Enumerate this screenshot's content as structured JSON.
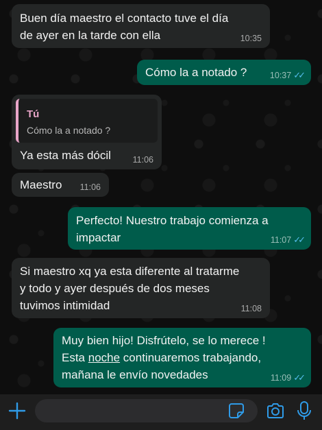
{
  "messages": [
    {
      "direction": "incoming",
      "lines": [
        "Buen día maestro el contacto tuve el día",
        "de ayer en la tarde  con ella"
      ],
      "time": "10:35"
    },
    {
      "direction": "outgoing",
      "text": "Cómo la a notado ?",
      "time": "10:37",
      "status": "read"
    },
    {
      "direction": "incoming",
      "reply_to": {
        "author": "Tú",
        "text": "Cómo la a notado ?"
      },
      "text": "Ya esta más dócil",
      "time": "11:06"
    },
    {
      "direction": "incoming",
      "text": "Maestro",
      "time": "11:06"
    },
    {
      "direction": "outgoing",
      "lines": [
        "Perfecto! Nuestro trabajo comienza a",
        "impactar"
      ],
      "time": "11:07",
      "status": "read"
    },
    {
      "direction": "incoming",
      "lines": [
        "Si maestro xq ya esta diferente al tratarme",
        "y todo y ayer después de dos meses",
        "tuvimos intimidad"
      ],
      "time": "11:08"
    },
    {
      "direction": "outgoing",
      "lines": [
        "Muy bien hijo! Disfrútelo, se lo merece !",
        "Esta ",
        "noche",
        " continuaremos trabajando,",
        "mañana le envío novedades"
      ],
      "time": "11:09",
      "status": "read"
    }
  ],
  "composer": {
    "placeholder": ""
  },
  "icons": {
    "attach": "plus-icon",
    "sticker": "sticker-icon",
    "camera": "camera-icon",
    "microphone": "microphone-icon",
    "read_receipt": "double-check-icon"
  },
  "colors": {
    "incoming_bubble": "#242626",
    "outgoing_bubble": "#005c4b",
    "read_ticks": "#53bdeb",
    "accent": "#2f9be8",
    "quote_author": "#e8a5c8"
  }
}
